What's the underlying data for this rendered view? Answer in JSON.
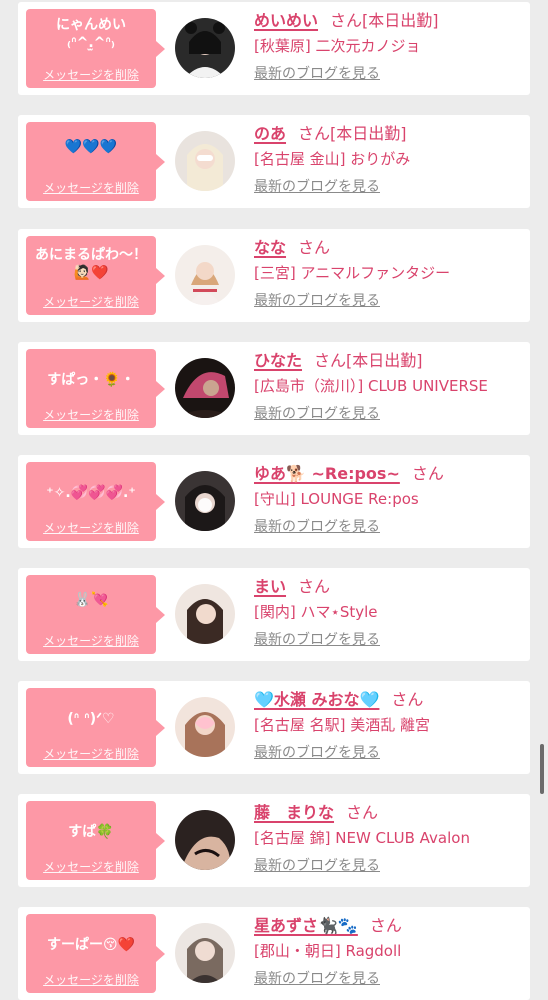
{
  "delete_label": "メッセージを削除",
  "blog_label": "最新のブログを見る",
  "honorific": "さん",
  "accent": "#d9436c",
  "bubble_color": "#fd98a6",
  "cards": [
    {
      "message": "にゃんめい\n₍ᐢ^.‎̫^ᐢ₎",
      "name": "めいめい",
      "status": "[本日出勤]",
      "shop": "[秋葉原] 二次元カノジョ"
    },
    {
      "message": "💙💙💙",
      "name": "のあ",
      "status": "[本日出勤]",
      "shop": "[名古屋 金山] おりがみ"
    },
    {
      "message": "あにまるぱわ〜！\n🙋🏻❤️",
      "name": "なな",
      "status": "",
      "shop": "[三宮] アニマルファンタジー"
    },
    {
      "message": "すぱっ・🌻・",
      "name": "ひなた",
      "status": "[本日出勤]",
      "shop": "[広島市（流川）] CLUB UNIVERSE"
    },
    {
      "message": "⁺✧.💞💞💞.⁺",
      "name": "ゆあ🐕 ~Re:pos~",
      "status": "",
      "shop": "[守山] LOUNGE Re:pos"
    },
    {
      "message": "🐰💘",
      "name": "まい",
      "status": "",
      "shop": "[関内] ハマ⋆Style"
    },
    {
      "message": "(ᐢ ᐢ)ᐟ♡",
      "name": "🩵水瀬 みおな🩵",
      "status": "",
      "shop": "[名古屋 名駅] 美酒乱 離宮"
    },
    {
      "message": "すぱ🍀",
      "name": "藤　まりな",
      "status": "",
      "shop": "[名古屋 錦] NEW CLUB Avalon"
    },
    {
      "message": "すーぱー😚❤️",
      "name": "星あずさ🐈‍⬛🐾",
      "status": "",
      "shop": "[郡山・朝日] Ragdoll"
    }
  ]
}
